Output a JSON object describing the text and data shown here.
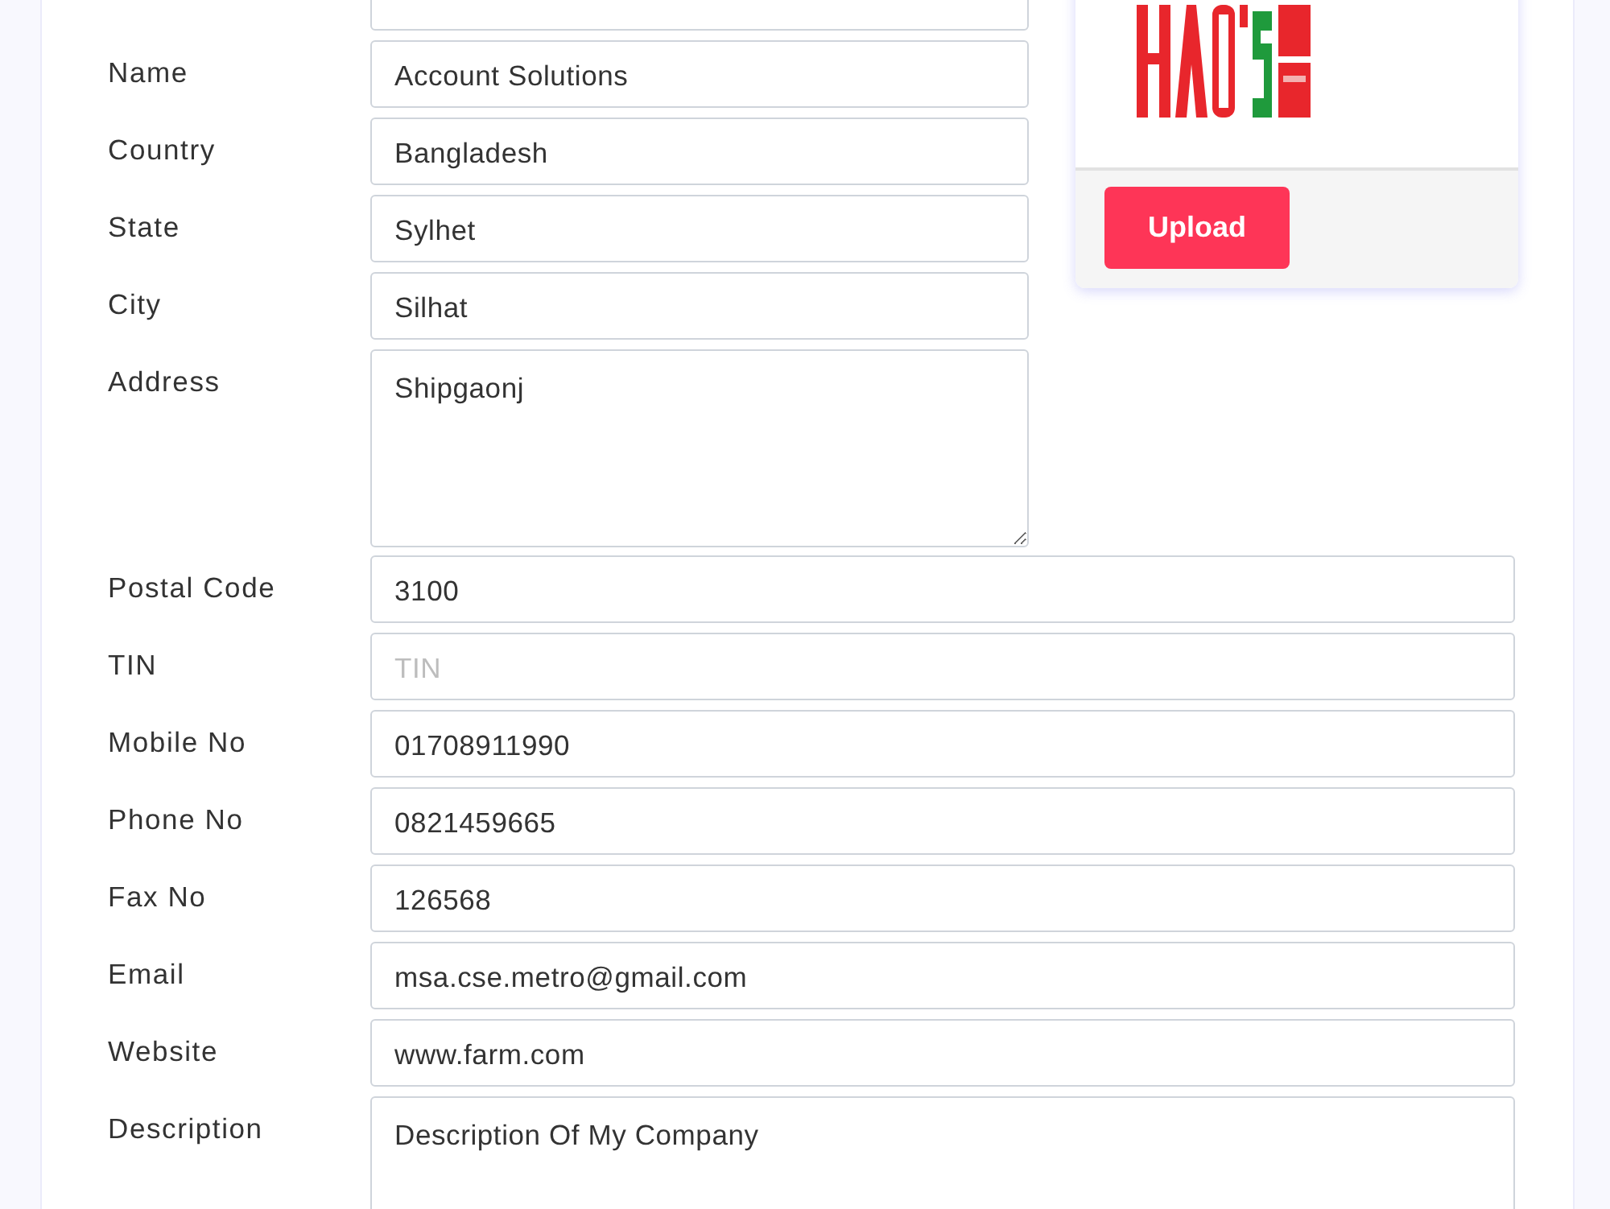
{
  "form": {
    "fields_beside_logo": [
      {
        "kind": "input"
      },
      {
        "label": "Name",
        "kind": "input",
        "value": "Account Solutions"
      },
      {
        "label": "Country",
        "kind": "input",
        "value": "Bangladesh"
      },
      {
        "label": "State",
        "kind": "input",
        "value": "Sylhet"
      },
      {
        "label": "City",
        "kind": "input",
        "value": "Silhat"
      },
      {
        "label": "Address",
        "kind": "textarea",
        "value": "Shipgaonj"
      }
    ],
    "fields_full_width": [
      {
        "label": "Postal Code",
        "kind": "input",
        "value": "3100"
      },
      {
        "label": "TIN",
        "kind": "input",
        "placeholder": "TIN"
      },
      {
        "label": "Mobile No",
        "kind": "input",
        "value": "01708911990"
      },
      {
        "label": "Phone No",
        "kind": "input",
        "value": "0821459665"
      },
      {
        "label": "Fax No",
        "kind": "input",
        "value": "126568"
      },
      {
        "label": "Email",
        "kind": "input",
        "value": "msa.cse.metro@gmail.com"
      },
      {
        "label": "Website",
        "kind": "input",
        "value": "www.farm.com"
      },
      {
        "label": "Description",
        "kind": "textarea",
        "value": "Description Of My Company"
      }
    ]
  },
  "logo_panel": {
    "upload_button": "Upload"
  }
}
